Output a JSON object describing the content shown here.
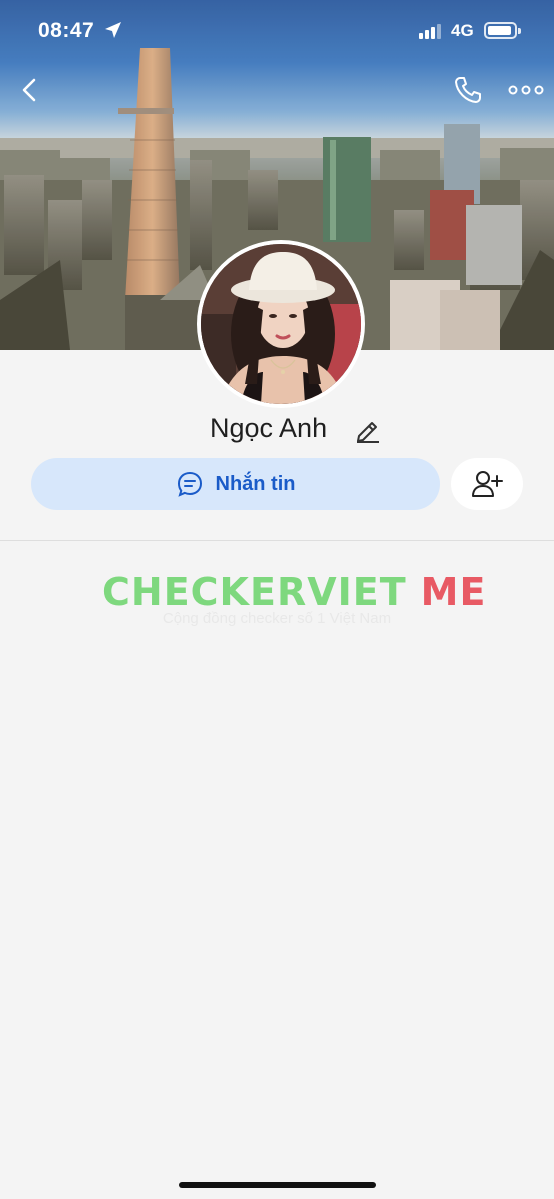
{
  "status_bar": {
    "time": "08:47",
    "network": "4G"
  },
  "nav": {
    "back_icon": "chevron-left-icon",
    "call_icon": "phone-icon",
    "more_icon": "ellipsis-icon"
  },
  "profile": {
    "name": "Ngọc Anh",
    "edit_icon": "pencil-icon"
  },
  "actions": {
    "message_label": "Nhắn tin",
    "message_icon": "chat-bubble-icon",
    "add_friend_icon": "add-user-icon"
  },
  "watermark": {
    "part1": "CHECKERVIET",
    "part2": "ME",
    "subtitle": "Cộng đồng checker số 1 Việt Nam"
  },
  "colors": {
    "accent_blue": "#1a5bc8",
    "message_button_bg": "#d7e7fb",
    "watermark_green": "#7ed87e",
    "watermark_red": "#e85a64"
  }
}
